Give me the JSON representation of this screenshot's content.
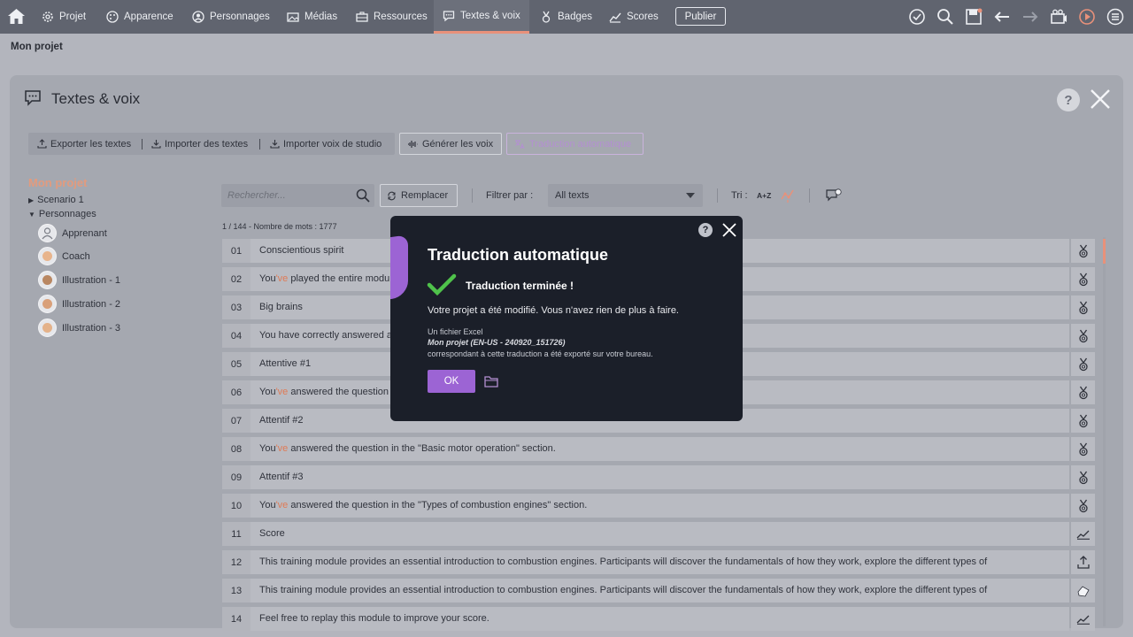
{
  "nav": {
    "items": [
      {
        "label": "Projet",
        "icon": "gear-icon"
      },
      {
        "label": "Apparence",
        "icon": "palette-icon"
      },
      {
        "label": "Personnages",
        "icon": "person-icon"
      },
      {
        "label": "Médias",
        "icon": "media-icon"
      },
      {
        "label": "Ressources",
        "icon": "briefcase-icon"
      },
      {
        "label": "Textes & voix",
        "icon": "speech-bubble-icon"
      },
      {
        "label": "Badges",
        "icon": "medal-icon"
      },
      {
        "label": "Scores",
        "icon": "chart-icon"
      }
    ],
    "active": "Textes & voix",
    "publish_label": "Publier",
    "accent_color": "#e8917a"
  },
  "breadcrumb": "Mon projet",
  "panel": {
    "title": "Textes & voix",
    "help": "?",
    "toolbar": {
      "export": "Exporter les textes",
      "import": "Importer des textes",
      "import_voice": "Importer voix de studio",
      "generate": "Générer les voix",
      "auto_translate": "Traduction automatique"
    }
  },
  "tree": {
    "title": "Mon projet",
    "scenario": "Scenario 1",
    "characters_label": "Personnages",
    "characters": [
      "Apprenant",
      "Coach",
      "Illustration - 1",
      "Illustration - 2",
      "Illustration - 3"
    ]
  },
  "search": {
    "placeholder": "Rechercher...",
    "replace_label": "Remplacer",
    "filter_label": "Filtrer par :",
    "filter_value": "All texts",
    "sort_label": "Tri :",
    "sort_az": "A+Z"
  },
  "count_line": "1 / 144  -  Nombre de mots : 1777",
  "rows": [
    {
      "num": "01",
      "pre": "",
      "hl": "",
      "text": "Conscientious spirit",
      "icon": "medal-icon"
    },
    {
      "num": "02",
      "pre": "You",
      "hl": "'ve",
      "text": " played the entire module.",
      "icon": "medal-icon"
    },
    {
      "num": "03",
      "pre": "",
      "hl": "",
      "text": "Big brains",
      "icon": "medal-icon"
    },
    {
      "num": "04",
      "pre": "",
      "hl": "",
      "text": "You have correctly answered all the questions.",
      "icon": "medal-icon"
    },
    {
      "num": "05",
      "pre": "",
      "hl": "",
      "text": "Attentive #1",
      "icon": "medal-icon"
    },
    {
      "num": "06",
      "pre": "You",
      "hl": "'ve",
      "text": " answered the question in the \"Engine components\" section.",
      "icon": "medal-icon"
    },
    {
      "num": "07",
      "pre": "",
      "hl": "",
      "text": "Attentif #2",
      "icon": "medal-icon"
    },
    {
      "num": "08",
      "pre": "You",
      "hl": "'ve",
      "text": " answered the question in the \"Basic motor operation\" section.",
      "icon": "medal-icon"
    },
    {
      "num": "09",
      "pre": "",
      "hl": "",
      "text": "Attentif #3",
      "icon": "medal-icon"
    },
    {
      "num": "10",
      "pre": "You",
      "hl": "'ve",
      "text": " answered the question in the \"Types of combustion engines\" section.",
      "icon": "medal-icon"
    },
    {
      "num": "11",
      "pre": "",
      "hl": "",
      "text": "Score",
      "icon": "chart-icon"
    },
    {
      "num": "12",
      "pre": "",
      "hl": "",
      "text": "This training module provides an essential introduction to combustion engines. Participants will discover the fundamentals of how they work, explore the different types of",
      "icon": "upload-icon"
    },
    {
      "num": "13",
      "pre": "",
      "hl": "",
      "text": "This training module provides an essential introduction to combustion engines. Participants will discover the fundamentals of how they work, explore the different types of",
      "icon": "hand-icon"
    },
    {
      "num": "14",
      "pre": "",
      "hl": "",
      "text": "Feel free to replay this module to improve your score.",
      "icon": "chart-icon"
    }
  ],
  "modal": {
    "title": "Traduction automatique",
    "done": "Traduction terminée !",
    "message": "Votre projet a été modifié. Vous n'avez rien de plus à faire.",
    "file_line1": "Un fichier Excel",
    "file_name": "Mon projet (EN-US - 240920_151726)",
    "file_line3": "correspondant à cette traduction a été exporté sur votre bureau.",
    "ok": "OK",
    "help": "?",
    "accent_color": "#9c64d4",
    "check_color": "#4fc24b"
  }
}
